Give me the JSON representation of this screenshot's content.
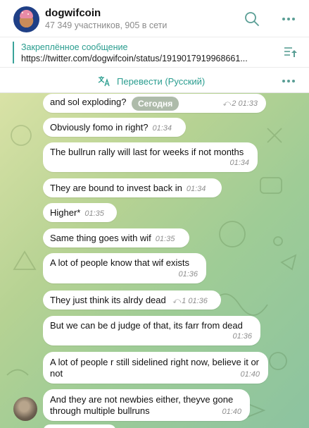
{
  "header": {
    "title": "dogwifcoin",
    "subtitle": "47 349 участников, 905 в сети"
  },
  "pinned": {
    "label": "Закреплённое сообщение",
    "link": "https://twitter.com/dogwifcoin/status/1919017919968661..."
  },
  "translate": {
    "label": "Перевести (Русский)"
  },
  "date_badge": "Сегодня",
  "messages": [
    {
      "text": "and sol exploding?",
      "time": "01:33",
      "replies": "2"
    },
    {
      "text": "Obviously fomo in right?",
      "time": "01:34"
    },
    {
      "text": "The bullrun rally will last for weeks if not months",
      "time": "01:34"
    },
    {
      "text": "They are bound to invest back in",
      "time": "01:34"
    },
    {
      "text": "Higher*",
      "time": "01:35"
    },
    {
      "text": "Same thing goes with wif",
      "time": "01:35"
    },
    {
      "text": "A lot of people know that wif exists",
      "time": "01:36"
    },
    {
      "text": "They just think its alrdy dead",
      "time": "01:36",
      "replies": "1"
    },
    {
      "text": "But we can be d judge of that, its farr from dead",
      "time": "01:36"
    },
    {
      "text": "A lot of people r still sidelined right now, believe it or not",
      "time": "01:40"
    },
    {
      "text": "And they are not newbies either, theyve gone through multiple bullruns",
      "time": "01:40"
    }
  ],
  "icons": {
    "search": "search-icon",
    "more": "more-dots-icon",
    "pinned_list": "pinned-list-icon",
    "translate": "translate-icon"
  },
  "colors": {
    "accent": "#2a9d8f",
    "bubble": "#ffffff"
  }
}
